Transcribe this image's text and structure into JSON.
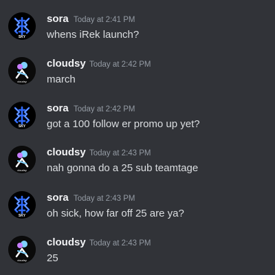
{
  "channel": {
    "messages": [
      {
        "username": "sora",
        "timestamp": "Today at 2:41 PM",
        "text": "whens iRek launch?",
        "avatar": "sora-sky-logo-icon"
      },
      {
        "username": "cloudsy",
        "timestamp": "Today at 2:42 PM",
        "text": "march",
        "avatar": "cloudsy-logo-icon"
      },
      {
        "username": "sora",
        "timestamp": "Today at 2:42 PM",
        "text": "got a 100 follow er promo up yet?",
        "avatar": "sora-sky-logo-icon"
      },
      {
        "username": "cloudsy",
        "timestamp": "Today at 2:43 PM",
        "text": "nah gonna do a 25 sub teamtage",
        "avatar": "cloudsy-logo-icon"
      },
      {
        "username": "sora",
        "timestamp": "Today at 2:43 PM",
        "text": "oh sick, how far off 25 are ya?",
        "avatar": "sora-sky-logo-icon"
      },
      {
        "username": "cloudsy",
        "timestamp": "Today at 2:43 PM",
        "text": "25",
        "avatar": "cloudsy-logo-icon"
      }
    ]
  },
  "avatars": {
    "sora_badge": "SKY",
    "cloudsy_badge": "cloudsy"
  },
  "colors": {
    "background": "#313338",
    "username": "#f2f3f5",
    "timestamp": "#949ba4",
    "message_text": "#dbdee1",
    "sora_avatar_accent": "#2f6bff",
    "cloudsy_avatar_accent": "#7fd0ff"
  }
}
